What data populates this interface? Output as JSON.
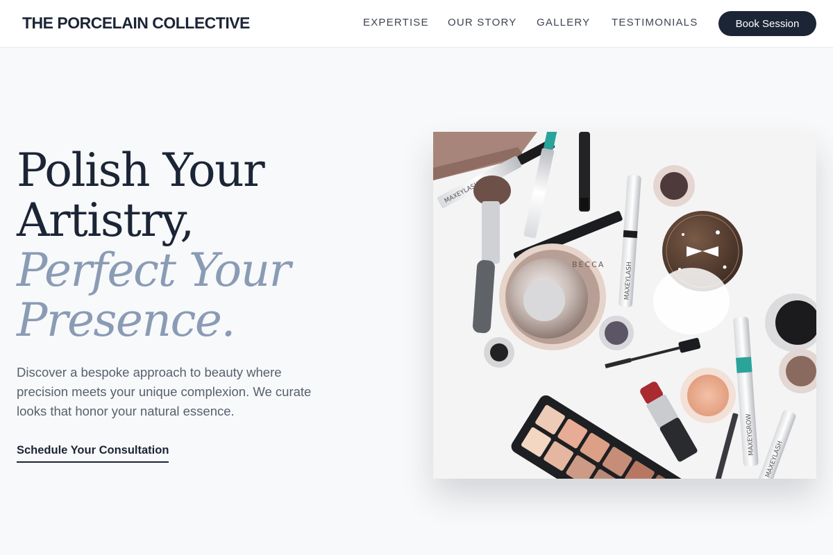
{
  "header": {
    "brand": "THE PORCELAIN COLLECTIVE",
    "nav": [
      "EXPERTISE",
      "OUR STORY",
      "GALLERY",
      "TESTIMONIALS"
    ],
    "cta_label": "Book Session"
  },
  "hero": {
    "headline_lines": [
      "Polish Your",
      "Artistry,"
    ],
    "headline_accent_lines": [
      "Perfect Your",
      "Presence."
    ],
    "description": "Discover a bespoke approach to beauty where precision meets your unique complexion. We curate looks that honor your natural essence.",
    "cta_label": "Schedule Your Consultation",
    "image": {
      "product_labels": [
        "MAXEYLASH",
        "MAXEYLASH",
        "MAXEYLASH",
        "MAXEYGROW",
        "BECCA"
      ]
    }
  },
  "colors": {
    "primary": "#1c2536",
    "accent": "#8a9bb5",
    "body_text": "#56606e",
    "page_bg": "#f8f9fa"
  }
}
